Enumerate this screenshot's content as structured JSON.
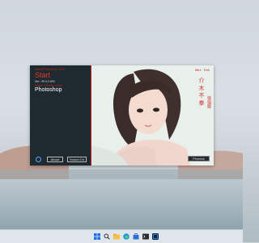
{
  "window": {
    "app_version_title": "Adobe Photoshop 2024",
    "start_title": "Start",
    "version_line": "Ver.: 25.4.2.400",
    "cloud_line": "Adobe Creative Cloud",
    "app_name": "Photoshop",
    "buttons": {
      "about": "About",
      "sound_on": "Sound On",
      "process": "Process"
    },
    "window_controls": {
      "minimize": "Mini",
      "exit": "Exit"
    },
    "cjk_title": "介 木 不 拳",
    "cjk_subtitle": "增强版"
  },
  "colors": {
    "accent_red": "#c62222",
    "panel_dark": "#1e2a2f",
    "settings_icon": "#5aa9ff"
  },
  "taskbar": {
    "icons": [
      "windows-start-icon",
      "search-icon",
      "file-explorer-icon",
      "edge-browser-icon",
      "store-icon",
      "terminal-icon",
      "photoshop-icon"
    ]
  }
}
